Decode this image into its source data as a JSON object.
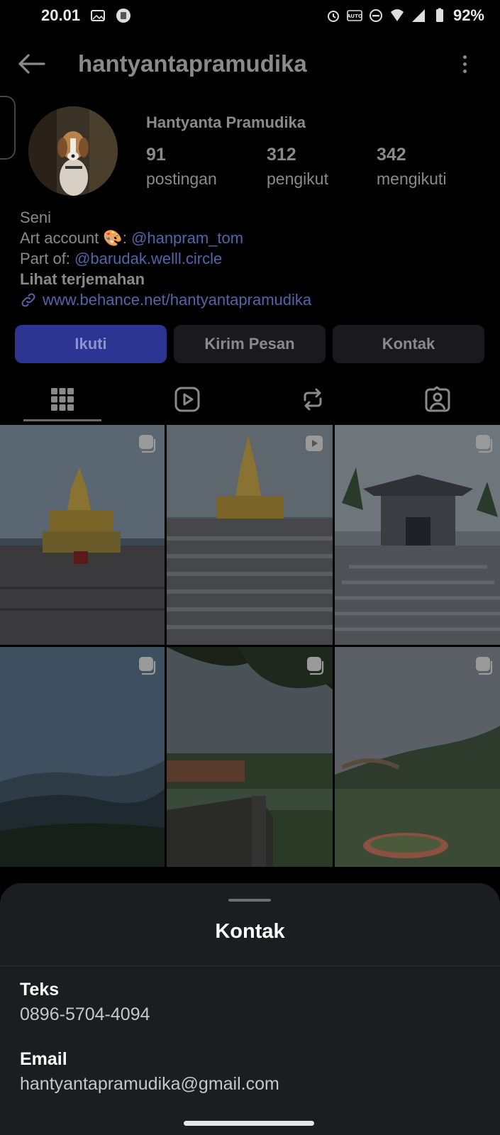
{
  "status_bar": {
    "time": "20.01",
    "battery": "92%"
  },
  "header": {
    "username": "hantyantapramudika"
  },
  "profile": {
    "display_name": "Hantyanta Pramudika",
    "stats": [
      {
        "value": "91",
        "label": "postingan"
      },
      {
        "value": "312",
        "label": "pengikut"
      },
      {
        "value": "342",
        "label": "mengikuti"
      }
    ],
    "bio": {
      "category": "Seni",
      "line1_prefix": "Art account 🎨: ",
      "line1_mention": "@hanpram_tom",
      "line2_prefix": "Part of: ",
      "line2_mention": "@barudak.welll.circle",
      "translate": "Lihat terjemahan",
      "link": "www.behance.net/hantyantapramudika"
    }
  },
  "actions": {
    "follow": "Ikuti",
    "message": "Kirim Pesan",
    "contact": "Kontak"
  },
  "tabs": [
    {
      "icon": "grid-icon"
    },
    {
      "icon": "reels-icon"
    },
    {
      "icon": "repost-icon"
    },
    {
      "icon": "tagged-icon"
    }
  ],
  "grid_posts": [
    {
      "subject": "golden-statue-plaza",
      "badge": "carousel-icon"
    },
    {
      "subject": "golden-statue-stairs",
      "badge": "video-icon"
    },
    {
      "subject": "temple-gate-stairs",
      "badge": "carousel-icon"
    },
    {
      "subject": "misty-mountains",
      "badge": "carousel-icon"
    },
    {
      "subject": "bridge-trees",
      "badge": "carousel-icon"
    },
    {
      "subject": "valley-bridge",
      "badge": "carousel-icon"
    }
  ],
  "sheet": {
    "title": "Kontak",
    "items": [
      {
        "label": "Teks",
        "value": "0896-5704-4094"
      },
      {
        "label": "Email",
        "value": "hantyantapramudika@gmail.com"
      }
    ]
  }
}
